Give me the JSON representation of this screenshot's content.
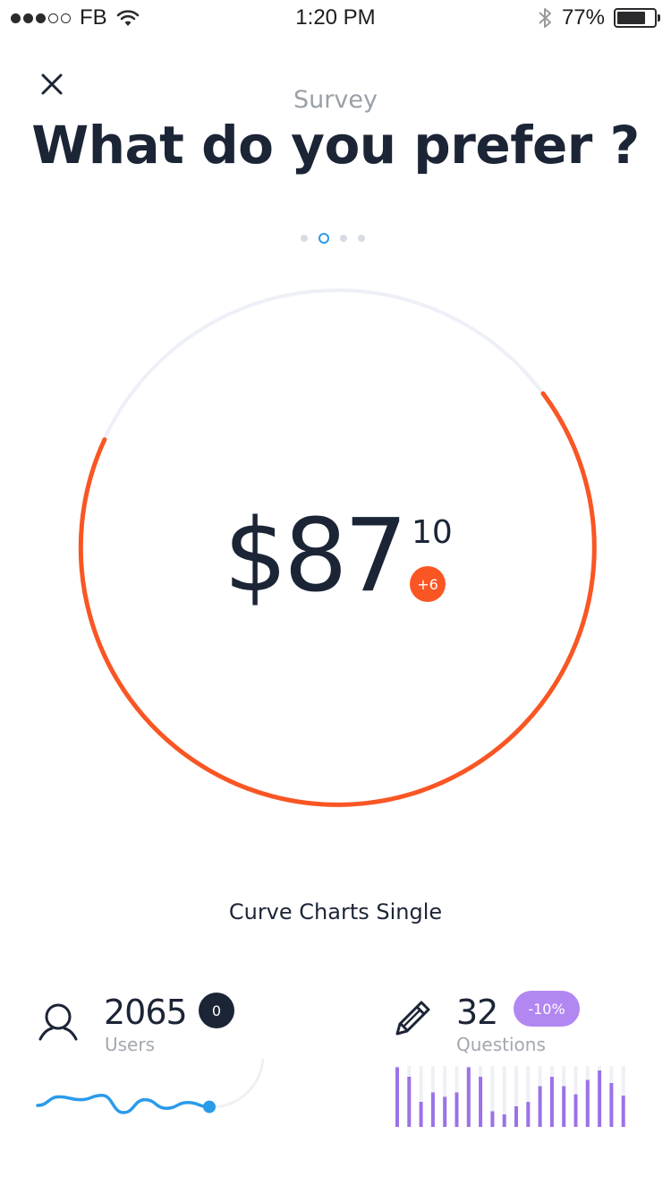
{
  "status_bar": {
    "carrier": "FB",
    "time": "1:20 PM",
    "battery": "77%",
    "battery_level": 0.77,
    "signal_strength": 3
  },
  "header": {
    "subtitle": "Survey",
    "title": "What do you prefer ?"
  },
  "pager": {
    "count": 4,
    "active_index": 1
  },
  "gauge": {
    "price": "$87",
    "cents": "10",
    "change": "+6",
    "accent_color": "#f95624",
    "track_color": "#eef0f8"
  },
  "caption": "Curve Charts Single",
  "stats": {
    "users": {
      "value": "2065",
      "label": "Users",
      "badge": "0"
    },
    "questions": {
      "value": "32",
      "label": "Questions",
      "badge": "-10%"
    }
  },
  "icons": {
    "close": "close-icon",
    "users": "user-icon",
    "questions": "pencil-icon"
  },
  "colors": {
    "dark": "#1c2536",
    "blue": "#2a9bea",
    "purple": "#9b72e8",
    "badge_purple": "#b287f2"
  },
  "chart_data": [
    {
      "type": "line",
      "series": [
        {
          "values": [
            0,
            6,
            4,
            7,
            -5,
            4,
            -2,
            2,
            -1
          ]
        }
      ]
    },
    {
      "type": "bar",
      "values": [
        0.95,
        0.8,
        0.4,
        0.55,
        0.48,
        0.55,
        0.95,
        0.8,
        0.25,
        0.2,
        0.33,
        0.4,
        0.65,
        0.8,
        0.65,
        0.52,
        0.75,
        0.9,
        0.7,
        0.5
      ]
    }
  ]
}
